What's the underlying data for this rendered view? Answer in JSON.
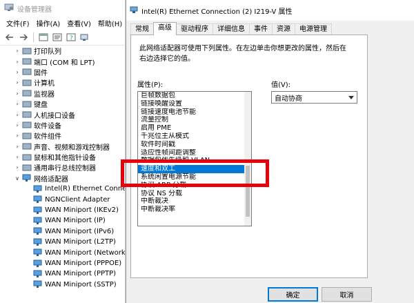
{
  "device_manager": {
    "title": "设备管理器",
    "menu": [
      "文件(F)",
      "操作(A)",
      "查看(V)",
      "帮助(H)"
    ],
    "categories": [
      {
        "label": "打印队列",
        "icon": "printer-icon"
      },
      {
        "label": "端口 (COM 和 LPT)",
        "icon": "port-icon"
      },
      {
        "label": "固件",
        "icon": "firmware-icon"
      },
      {
        "label": "计算机",
        "icon": "computer-icon"
      },
      {
        "label": "监视器",
        "icon": "monitor-icon"
      },
      {
        "label": "键盘",
        "icon": "keyboard-icon"
      },
      {
        "label": "人机接口设备",
        "icon": "hid-icon"
      },
      {
        "label": "软件设备",
        "icon": "software-device-icon"
      },
      {
        "label": "软件组件",
        "icon": "software-component-icon"
      },
      {
        "label": "声音、视频和游戏控制器",
        "icon": "sound-icon"
      },
      {
        "label": "鼠标和其他指针设备",
        "icon": "mouse-icon"
      },
      {
        "label": "通用串行总线控制器",
        "icon": "usb-icon"
      },
      {
        "label": "网络适配器",
        "icon": "network-adapter-icon"
      }
    ],
    "network_adapters": [
      "Intel(R) Ethernet Connecti",
      "NGNClient Adapter",
      "WAN Miniport (IKEv2)",
      "WAN Miniport (IP)",
      "WAN Miniport (IPv6)",
      "WAN Miniport (L2TP)",
      "WAN Miniport (Network",
      "WAN Miniport (PPPOE)",
      "WAN Miniport (PPTP)",
      "WAN Miniport (SSTP)"
    ]
  },
  "dialog": {
    "title": "Intel(R) Ethernet Connection (2) I219-V 属性",
    "tabs": [
      "常规",
      "高级",
      "驱动程序",
      "详细信息",
      "事件",
      "资源",
      "电源管理"
    ],
    "active_tab": "高级",
    "description": "此网络适配器可使用下列属性。在左边单击你想更改的属性，然后在右边选择它的值。",
    "properties_label": "属性(P):",
    "value_label": "值(V):",
    "properties": [
      "巨帧数据包",
      "链接唤醒设置",
      "链接速度电池节能",
      "流量控制",
      "启用 PME",
      "千兆位主从模式",
      "软件时间戳",
      "适应性帧间距调整",
      "数据包优先级和 VLAN",
      "速度和双工",
      "系统闲置电源节能",
      "协议 ARP 分载",
      "协议 NS 分载",
      "中断裁决",
      "中断裁决率"
    ],
    "selected_property": "速度和双工",
    "value": "自动协商",
    "ok_label": "确定",
    "cancel_label": "取消"
  },
  "colors": {
    "selection": "#0078d7",
    "highlight_box": "#e8000d",
    "dialog_bg": "#f0f0f0"
  }
}
